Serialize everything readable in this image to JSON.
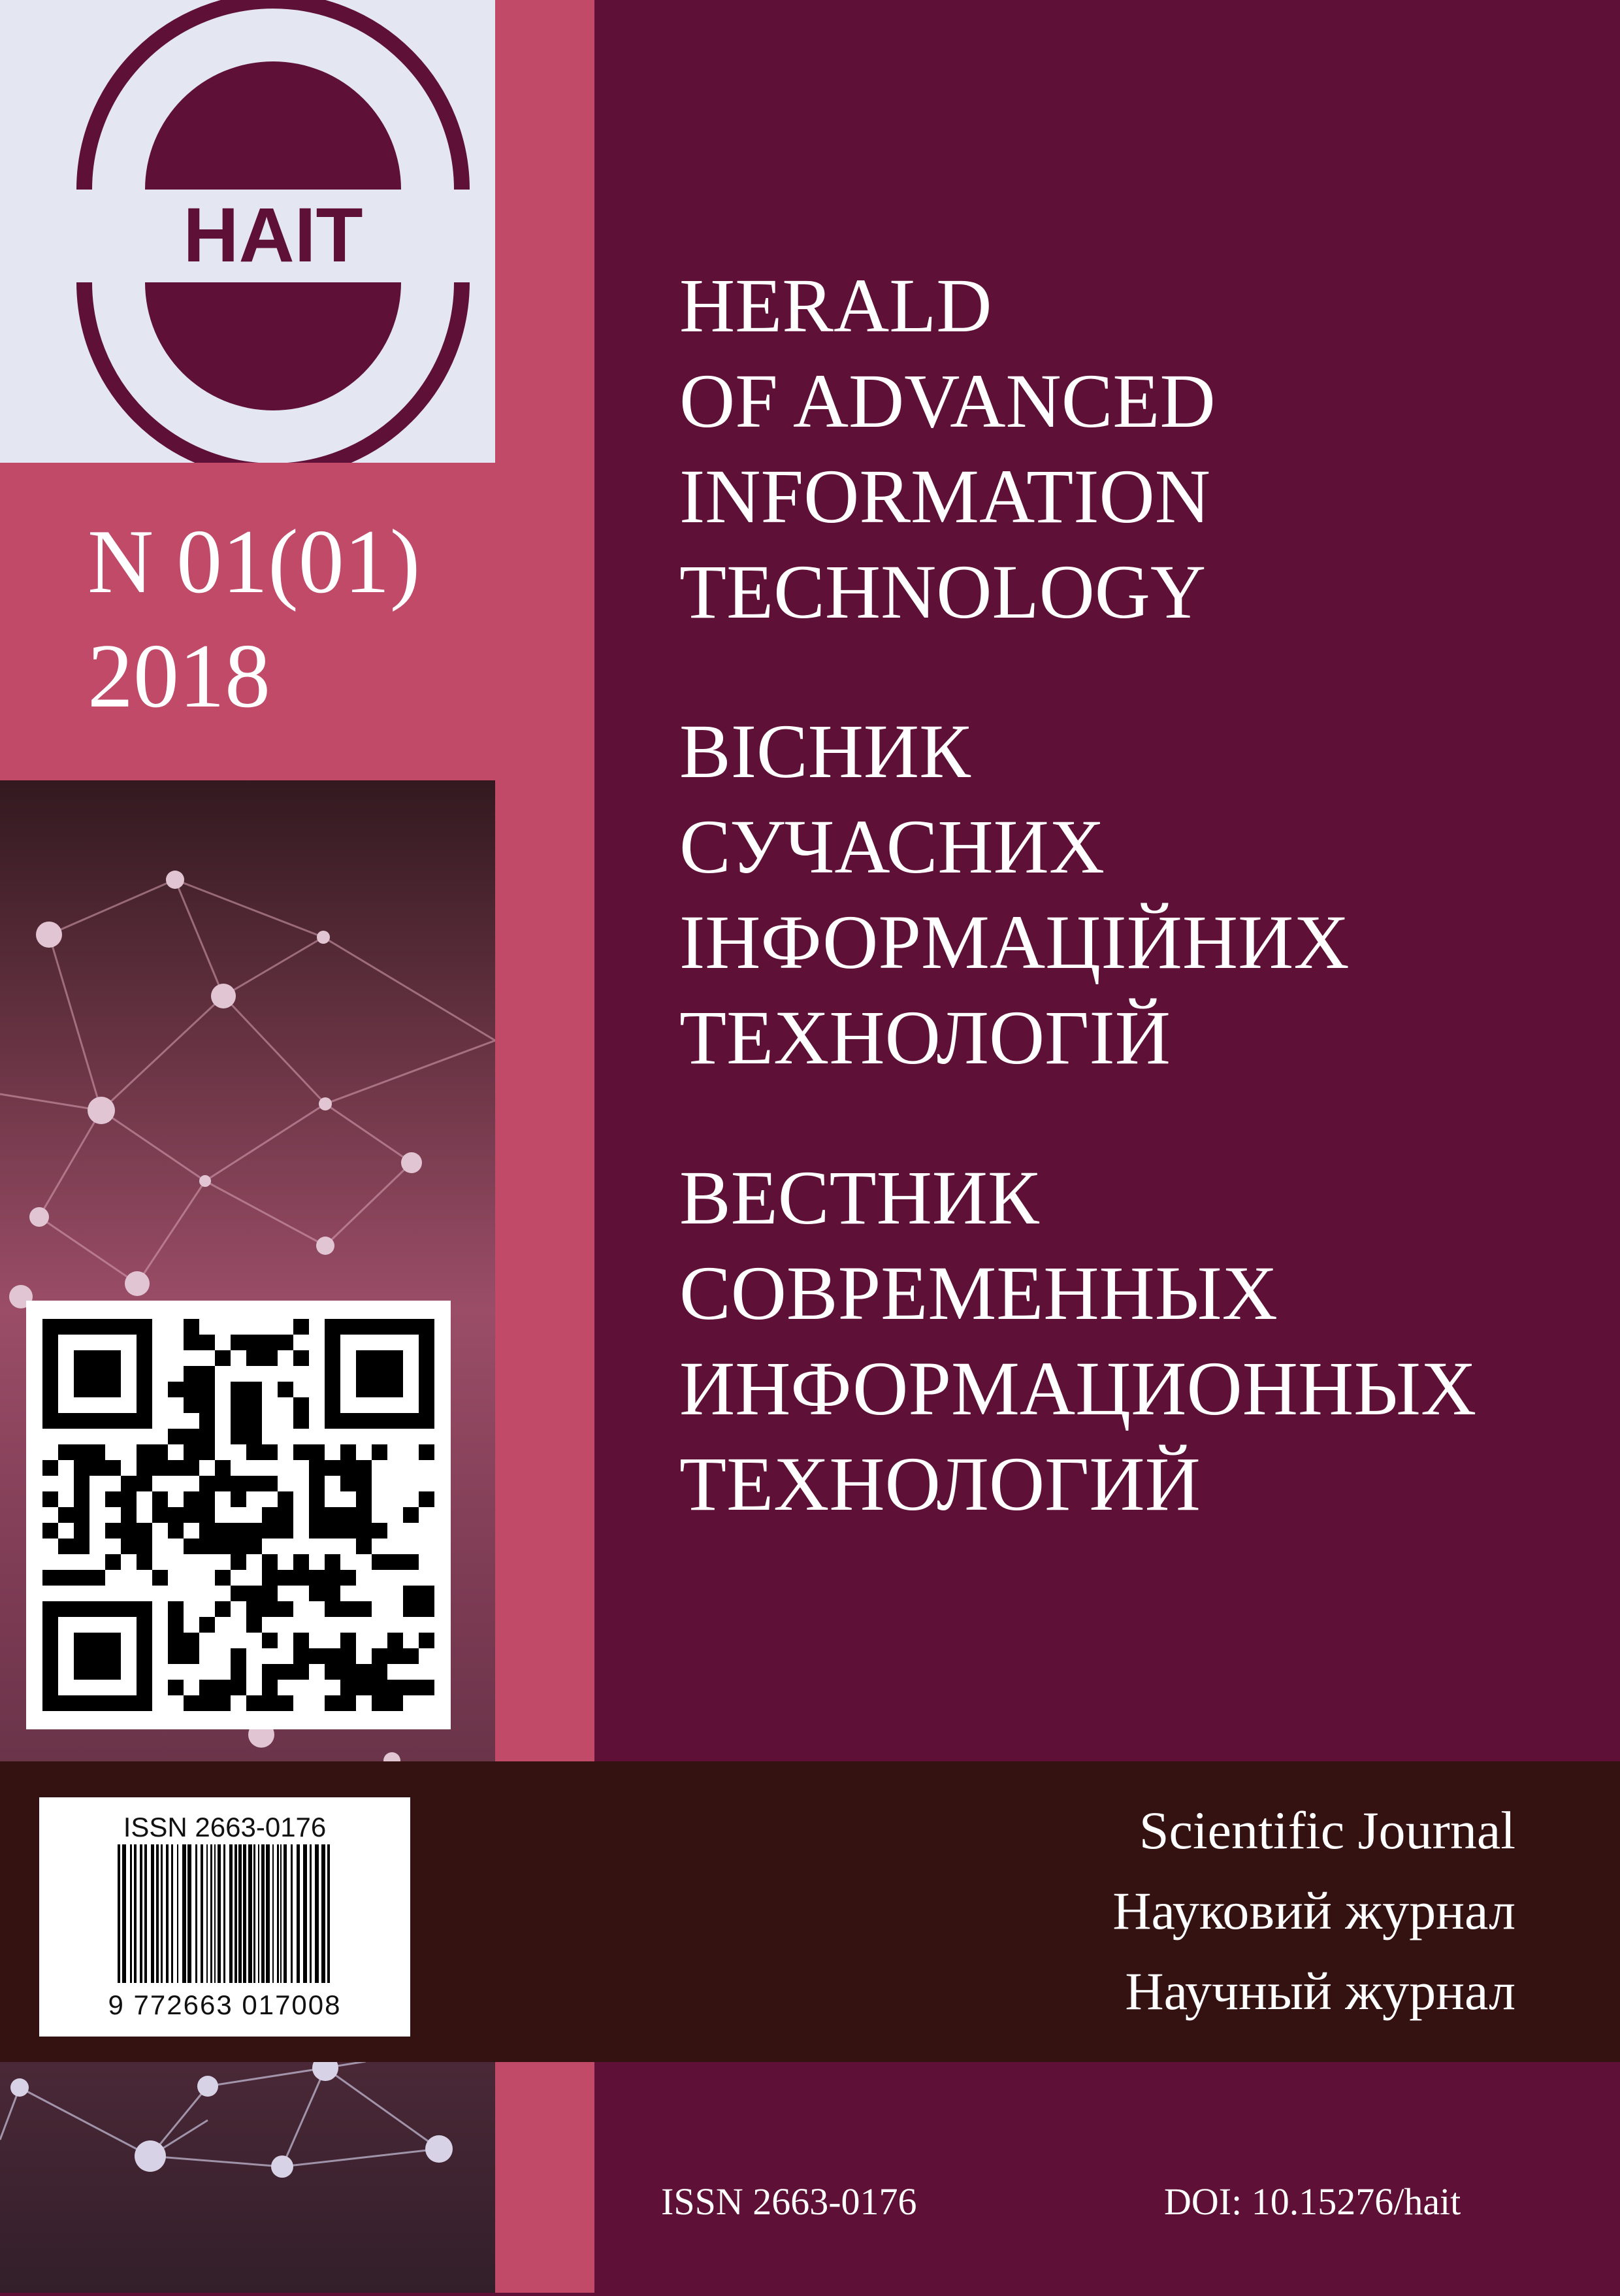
{
  "logo": {
    "text": "HAIT"
  },
  "issue": {
    "number": "N 01(01)",
    "year": "2018"
  },
  "titles": {
    "english": [
      "HERALD",
      "OF ADVANCED",
      "INFORMATION",
      "TECHNOLOGY"
    ],
    "ukrainian": [
      "ВІСНИК",
      "СУЧАСНИХ",
      "ІНФОРМАЦІЙНИХ",
      "ТЕХНОЛОГІЙ"
    ],
    "russian": [
      "ВЕСТНИК",
      "СОВРЕМЕННЫХ",
      "ИНФОРМАЦИОННЫХ",
      "ТЕХНОЛОГИЙ"
    ]
  },
  "subtitles": [
    "Scientific Journal",
    "Науковий журнал",
    "Научный журнал"
  ],
  "barcode": {
    "issn": "ISSN 2663-0176",
    "digits": "9  772663  017008"
  },
  "footer": {
    "issn": "ISSN 2663-0176",
    "doi": "DOI: 10.15276/hait"
  },
  "colors": {
    "background": "#5e1036",
    "accent_pink": "#c04a68",
    "logo_panel": "#e4e6f1",
    "band": "#351212"
  }
}
